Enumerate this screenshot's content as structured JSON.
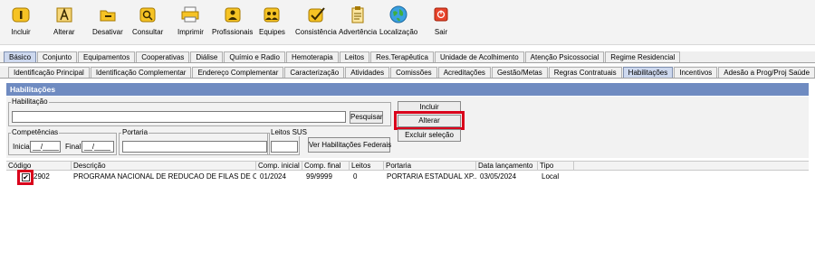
{
  "toolbar": {
    "buttons": [
      {
        "label": "Incluir",
        "icon": "include-icon"
      },
      {
        "label": "Alterar",
        "icon": "edit-icon"
      },
      {
        "label": "Desativar",
        "icon": "deactivate-icon"
      },
      {
        "label": "Consultar",
        "icon": "search-icon"
      },
      {
        "label": "Imprimir",
        "icon": "printer-icon"
      },
      {
        "label": "Profissionais",
        "icon": "professionals-icon"
      },
      {
        "label": "Equipes",
        "icon": "teams-icon"
      },
      {
        "label": "Consistência",
        "icon": "consistency-icon"
      },
      {
        "label": "Advertência",
        "icon": "clipboard-icon"
      },
      {
        "label": "Localização",
        "icon": "globe-icon"
      },
      {
        "label": "Sair",
        "icon": "exit-icon"
      }
    ]
  },
  "tabs_primary": [
    "Básico",
    "Conjunto",
    "Equipamentos",
    "Cooperativas",
    "Diálise",
    "Químio e Radio",
    "Hemoterapia",
    "Leitos",
    "Res.Terapêutica",
    "Unidade de Acolhimento",
    "Atenção Psicossocial",
    "Regime Residencial"
  ],
  "tabs_secondary": [
    "Identificação Principal",
    "Identificação Complementar",
    "Endereço Complementar",
    "Caracterização",
    "Atividades",
    "Comissões",
    "Acreditações",
    "Gestão/Metas",
    "Regras Contratuais",
    "Habilitações",
    "Incentivos",
    "Adesão a Prog/Proj Saúde"
  ],
  "active_primary_tab": "Básico",
  "active_secondary_tab": "Habilitações",
  "section": {
    "title": "Habilitações"
  },
  "form": {
    "habilitacao_legend": "Habilitação",
    "habilitacao_value": "",
    "pesquisar_label": "Pesquisar",
    "competencias_legend": "Competências",
    "inicial_label": "Inicial",
    "inicial_value": "__/____",
    "final_label": "Final",
    "final_value": "__/____",
    "portaria_legend": "Portaria",
    "portaria_value": "",
    "leitos_legend": "Leitos SUS",
    "leitos_value": "",
    "ver_federais_label": "Ver Habilitações Federais",
    "incluir_label": "Incluir",
    "alterar_label": "Alterar",
    "excluir_label": "Excluir seleção"
  },
  "grid": {
    "columns": [
      "Código",
      "Descrição",
      "Comp. inicial",
      "Comp. final",
      "Leitos",
      "Portaria",
      "Data lançamento",
      "Tipo"
    ],
    "rows": [
      {
        "codigo": "2902",
        "descricao": "PROGRAMA NACIONAL DE REDUCAO DE FILAS DE CIRU...",
        "comp_inicial": "01/2024",
        "comp_final": "99/9999",
        "leitos": "0",
        "portaria": "PORTARIA ESTADUAL XP...",
        "data_lancamento": "03/05/2024",
        "tipo": "Local",
        "checked": true
      }
    ]
  },
  "colors": {
    "section_bar": "#6f8bc1",
    "highlight": "#d9001b",
    "active_tab": "#cdd8ee"
  }
}
